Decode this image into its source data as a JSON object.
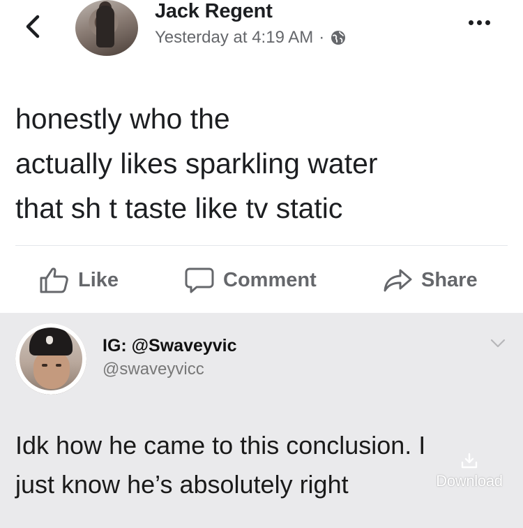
{
  "post": {
    "author": "Jack Regent",
    "timestamp": "Yesterday at 4:19 AM",
    "separator": "·",
    "privacy_icon": "globe-icon",
    "text_lines": [
      "honestly who the",
      "actually likes sparkling water",
      "that sh t taste like tv static"
    ],
    "actions": {
      "like": "Like",
      "comment": "Comment",
      "share": "Share"
    }
  },
  "tweet": {
    "display_name": "IG: @Swaveyvic",
    "handle": "@swaveyvicc",
    "text_lines": [
      "Idk how he came to this conclusion. I",
      "just know he’s absolutely right"
    ]
  },
  "overlay": {
    "download_label": "Download"
  },
  "colors": {
    "text_primary": "#1c1e21",
    "text_secondary": "#65676b",
    "tweet_bg": "#eaeaec"
  }
}
